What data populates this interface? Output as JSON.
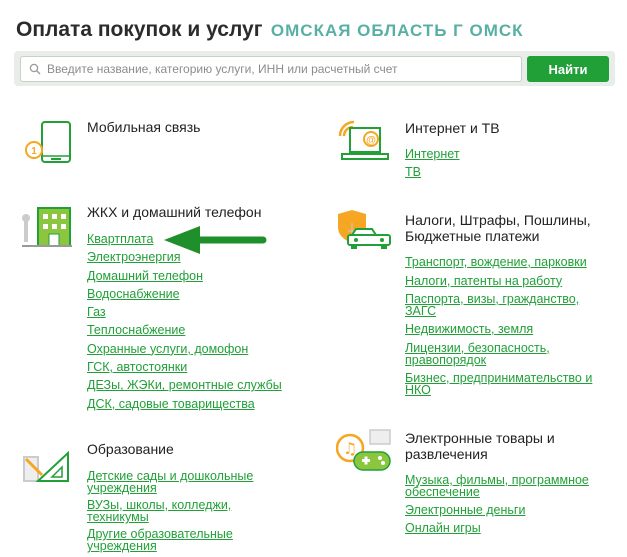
{
  "header": {
    "title": "Оплата покупок и услуг",
    "region": "ОМСКАЯ ОБЛАСТЬ Г ОМСК"
  },
  "search": {
    "placeholder": "Введите название, категорию услуги, ИНН или расчетный счет",
    "value": "",
    "button_label": "Найти"
  },
  "colors": {
    "accent": "#21a038",
    "icon_orange": "#f5a623",
    "region": "#58b0a4"
  },
  "categories": {
    "mobile": {
      "title": "Мобильная связь",
      "icon": "smartphone-icon",
      "links": []
    },
    "internet": {
      "title": "Интернет и ТВ",
      "icon": "laptop-email-icon",
      "links": [
        "Интернет",
        "ТВ"
      ]
    },
    "housing": {
      "title": "ЖКХ и домашний телефон",
      "icon": "building-icon",
      "links": [
        "Квартплата",
        "Электроэнергия",
        "Домашний телефон",
        "Водоснабжение",
        "Газ",
        "Теплоснабжение",
        "Охранные услуги, домофон",
        "ГСК, автостоянки",
        "ДЕЗы, ЖЭКи, ремонтные службы",
        "ДСК, садовые товарищества"
      ]
    },
    "taxes": {
      "title_lines": [
        "Налоги, Штрафы, Пошлины,",
        "Бюджетные платежи"
      ],
      "icon": "car-shield-icon",
      "links": [
        [
          "Транспорт, вождение, парковки"
        ],
        [
          "Налоги, патенты на работу"
        ],
        [
          "Паспорта, визы, гражданство,",
          "ЗАГС"
        ],
        [
          "Недвижимость, земля"
        ],
        [
          "Лицензии, безопасность,",
          "правопорядок"
        ],
        [
          "Бизнес, предпринимательство и",
          "НКО"
        ]
      ]
    },
    "education": {
      "title": "Образование",
      "icon": "education-tools-icon",
      "links": [
        [
          "Детские сады и дошкольные",
          "учреждения"
        ],
        [
          "ВУЗы, школы, колледжи,",
          "техникумы"
        ],
        [
          "Другие образовательные",
          "учреждения"
        ]
      ]
    },
    "electronic": {
      "title_lines": [
        "Электронные товары и",
        "развлечения"
      ],
      "icon": "gamepad-music-icon",
      "links": [
        [
          "Музыка, фильмы, программное",
          "обеспечение"
        ],
        [
          "Электронные деньги"
        ],
        [
          "Онлайн игры"
        ]
      ]
    }
  }
}
